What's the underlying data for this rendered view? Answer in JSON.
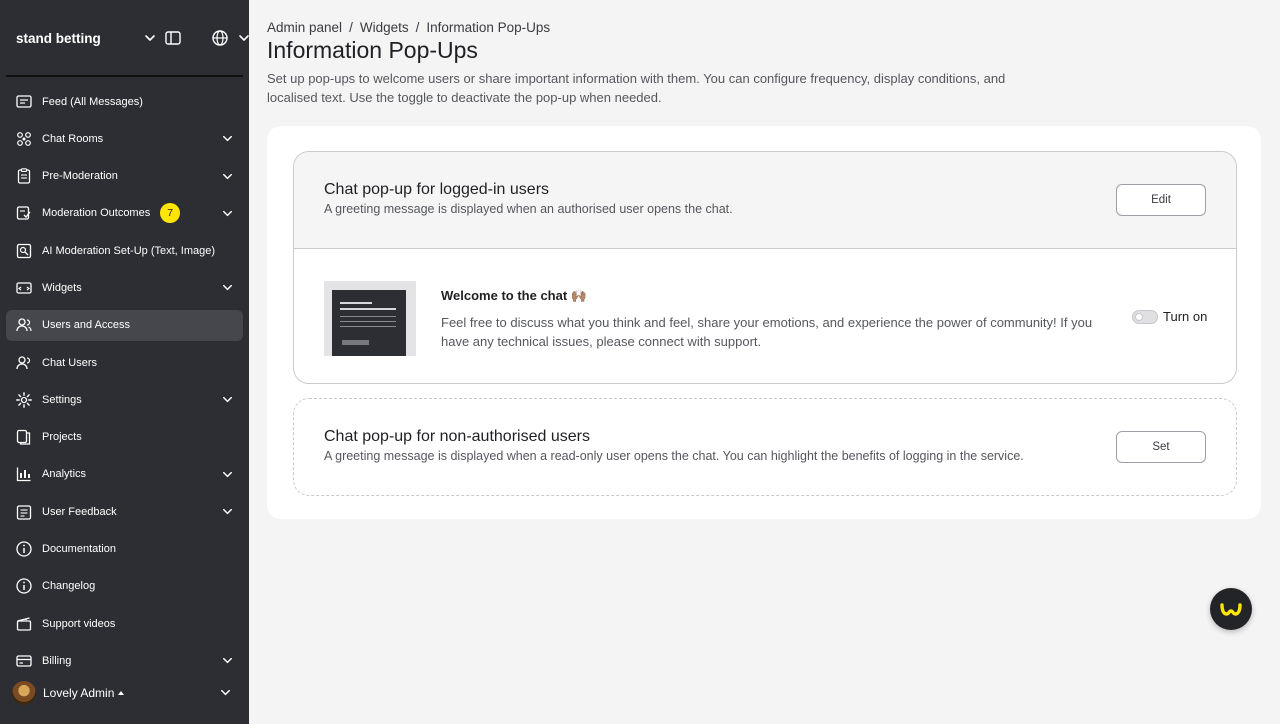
{
  "sidebar": {
    "brand": "stand betting",
    "items": [
      {
        "label": "Feed (All Messages)",
        "icon": "feed-icon",
        "chevron": false
      },
      {
        "label": "Chat Rooms",
        "icon": "chat-rooms-icon",
        "chevron": true
      },
      {
        "label": "Pre-Moderation",
        "icon": "clipboard-icon",
        "chevron": true
      },
      {
        "label": "Moderation Outcomes",
        "icon": "outcomes-icon",
        "chevron": true,
        "badge": "7"
      },
      {
        "label": "AI Moderation Set-Up (Text, Image)",
        "icon": "ai-moderation-icon",
        "chevron": false
      },
      {
        "label": "Widgets",
        "icon": "widgets-icon",
        "chevron": true
      },
      {
        "label": "Users and Access",
        "icon": "users-access-icon",
        "chevron": false,
        "active": true
      },
      {
        "label": "Chat Users",
        "icon": "chat-users-icon",
        "chevron": false
      },
      {
        "label": "Settings",
        "icon": "gear-icon",
        "chevron": true
      },
      {
        "label": "Projects",
        "icon": "projects-icon",
        "chevron": false
      },
      {
        "label": "Analytics",
        "icon": "analytics-icon",
        "chevron": true
      },
      {
        "label": "User Feedback",
        "icon": "feedback-icon",
        "chevron": true
      },
      {
        "label": "Documentation",
        "icon": "info-icon",
        "chevron": false
      },
      {
        "label": "Changelog",
        "icon": "info-icon",
        "chevron": false
      },
      {
        "label": "Support videos",
        "icon": "video-icon",
        "chevron": false
      },
      {
        "label": "Billing",
        "icon": "billing-icon",
        "chevron": true
      }
    ],
    "user": {
      "name": "Lovely Admin"
    }
  },
  "breadcrumb": {
    "items": [
      "Admin panel",
      "Widgets",
      "Information Pop-Ups"
    ],
    "separator": "/"
  },
  "page": {
    "title": "Information Pop-Ups",
    "description": "Set up pop-ups to welcome users or share important information with them. You can configure frequency, display conditions, and localised text. Use the toggle to deactivate the pop-up when needed."
  },
  "cards": {
    "logged_in": {
      "title": "Chat pop-up for logged-in users",
      "subtitle": "A greeting message is displayed when an authorised user opens the chat.",
      "button": "Edit",
      "message_title": "Welcome to the chat 🙌🏽",
      "message_text": "Feel free to discuss what you think and feel, share your emotions, and experience the power of community! If you have any technical issues, please connect with support.",
      "toggle_label": "Turn on",
      "toggle_on": false
    },
    "non_authorised": {
      "title": "Chat pop-up for non-authorised users",
      "subtitle": "A greeting message is displayed when a read-only user opens the chat. You can highlight the benefits of logging in the service.",
      "button": "Set"
    }
  },
  "colors": {
    "sidebar_bg": "#2d2e33",
    "active_item_bg": "#45474d",
    "badge": "#ffe600",
    "fab_bg": "#232428",
    "fab_icon": "#ffe600"
  }
}
